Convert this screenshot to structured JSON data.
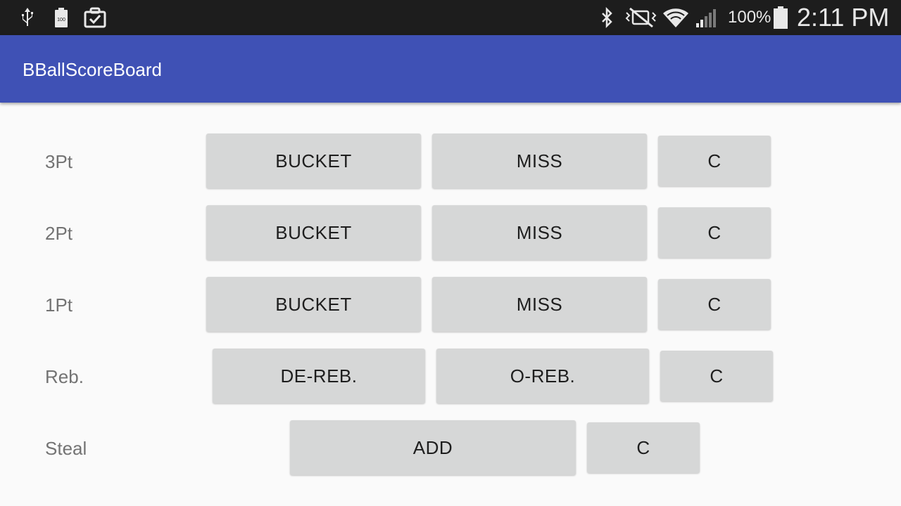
{
  "status_bar": {
    "battery_percent": "100%",
    "time": "2:11 PM",
    "icons": [
      "usb-icon",
      "battery-saver-icon",
      "clipboard-check-icon",
      "bluetooth-icon",
      "vibrate-off-icon",
      "wifi-icon",
      "signal-icon",
      "battery-icon"
    ]
  },
  "app_bar": {
    "title": "BBallScoreBoard",
    "color": "#3f51b5"
  },
  "rows": {
    "three_pt": {
      "label": "3Pt",
      "bucket": "BUCKET",
      "miss": "MISS",
      "clear": "C"
    },
    "two_pt": {
      "label": "2Pt",
      "bucket": "BUCKET",
      "miss": "MISS",
      "clear": "C"
    },
    "one_pt": {
      "label": "1Pt",
      "bucket": "BUCKET",
      "miss": "MISS",
      "clear": "C"
    },
    "rebound": {
      "label": "Reb.",
      "defensive": "DE-REB.",
      "offensive": "O-REB.",
      "clear": "C"
    },
    "steal": {
      "label": "Steal",
      "add": "ADD",
      "clear": "C"
    }
  },
  "colors": {
    "button_bg": "#d6d7d7",
    "label_text": "#737373",
    "background": "#fafafa"
  }
}
